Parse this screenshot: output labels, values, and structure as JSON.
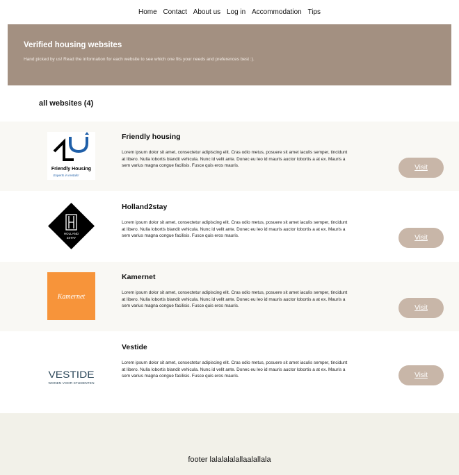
{
  "nav": {
    "items": [
      "Home",
      "Contact",
      "About us",
      "Log in",
      "Accommodation",
      "Tips"
    ]
  },
  "hero": {
    "title": "Verified housing websites",
    "subtitle": "Hand picked by us! Read the information for each website to see which one fits your needs and preferences best :)."
  },
  "list": {
    "heading": "all websites (4)",
    "sites": [
      {
        "name": "Friendly housing",
        "description": "Lorem ipsum dolor sit amet, consectetur adipiscing elit. Cras odio metus, posuere sit amet iaculis semper, tincidunt at libero. Nulla lobortis blandit vehicula. Nunc id velit ante. Donec eu leo id mauris auctor lobortis a at ex. Mauris a sem varius magna congue facilisis. Fusce quis eros mauris.",
        "button": "Visit",
        "logo_text": [
          "Friendly Housing",
          "Experts in rentals!"
        ]
      },
      {
        "name": "Holland2stay",
        "description": "Lorem ipsum dolor sit amet, consectetur adipiscing elit. Cras odio metus, posuere sit amet iaculis semper, tincidunt at libero. Nulla lobortis blandit vehicula. Nunc id velit ante. Donec eu leo id mauris auctor lobortis a at ex. Mauris a sem varius magna congue facilisis. Fusce quis eros mauris.",
        "button": "Visit",
        "logo_text": [
          "HOLLAND",
          "2STAY"
        ]
      },
      {
        "name": "Kamernet",
        "description": "Lorem ipsum dolor sit amet, consectetur adipiscing elit. Cras odio metus, posuere sit amet iaculis semper, tincidunt at libero. Nulla lobortis blandit vehicula. Nunc id velit ante. Donec eu leo id mauris auctor lobortis a at ex. Mauris a sem varius magna congue facilisis. Fusce quis eros mauris.",
        "button": "Visit",
        "logo_text": [
          "Kamernet"
        ]
      },
      {
        "name": "Vestide",
        "description": "Lorem ipsum dolor sit amet, consectetur adipiscing elit. Cras odio metus, posuere sit amet iaculis semper, tincidunt at libero. Nulla lobortis blandit vehicula. Nunc id velit ante. Donec eu leo id mauris auctor lobortis a at ex. Mauris a sem varius magna congue facilisis. Fusce quis eros mauris.",
        "button": "Visit",
        "logo_text": [
          "VESTIDE",
          "WONEN VOOR STUDENTEN"
        ]
      }
    ]
  },
  "footer": {
    "text": "footer lalalalalallaalallala"
  },
  "colors": {
    "hero_bg": "#a39081",
    "button_bg": "#c8b6a8",
    "alt_row_bg": "#f9f8f4",
    "footer_bg": "#f2f1e9",
    "kamernet_orange": "#f7943a",
    "vestide_navy": "#2f4a5c",
    "friendly_blue": "#1f5fa8"
  }
}
